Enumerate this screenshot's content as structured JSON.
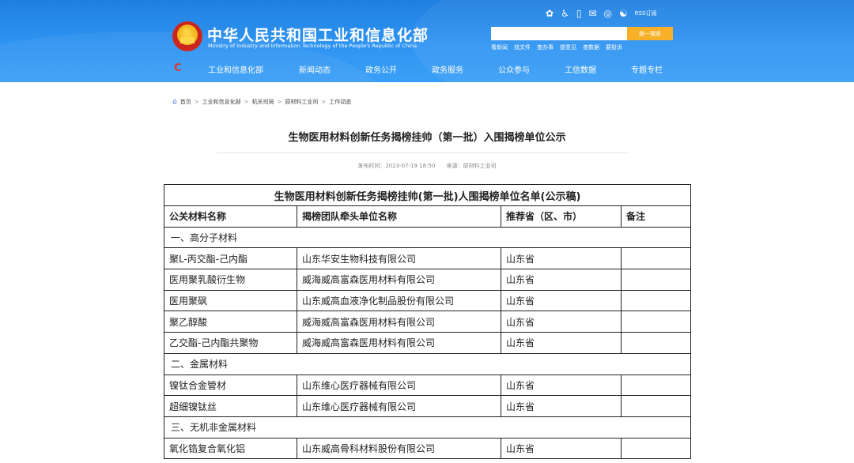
{
  "header": {
    "site_title": "中华人民共和国工业和信息化部",
    "site_subtitle": "Ministry of Industry and Information Technology of the People's Republic of China",
    "utility_icons": [
      "wechat-icon",
      "accessibility-icon",
      "mobile-icon",
      "mail-icon",
      "chat-icon",
      "weibo-icon"
    ],
    "rss_label": "RSS订阅",
    "search": {
      "placeholder": "",
      "button_label": "换一搜索"
    },
    "hot_links": [
      "看新闻",
      "找文件",
      "查办事",
      "提意见",
      "查数据",
      "要投诉"
    ],
    "nav_logo": "C",
    "nav": [
      "工业和信息化部",
      "新闻动态",
      "政务公开",
      "政务服务",
      "公众参与",
      "工信数据",
      "专题专栏"
    ]
  },
  "breadcrumb": [
    "首页",
    "工业和信息化部",
    "机关司局",
    "原材料工业司",
    "工作动态"
  ],
  "article": {
    "title": "生物医用材料创新任务揭榜挂帅（第一批）入围揭榜单位公示",
    "publish_time": "发布时间：2023-07-19 18:50",
    "source": "来源：原材料工业司"
  },
  "table": {
    "caption": "生物医用材料创新任务揭榜挂帅(第一批)人围揭榜单位名单(公示稿)",
    "headers": [
      "公关材料名称",
      "揭榜团队牵头单位名称",
      "推荐省（区、市）",
      "备注"
    ],
    "rows": [
      {
        "category": "一、高分子材料"
      },
      {
        "cells": [
          "聚L-丙交酯-己内酯",
          "山东华安生物科技有限公司",
          "山东省",
          ""
        ]
      },
      {
        "cells": [
          "医用聚乳酸衍生物",
          "威海威高富森医用材料有限公司",
          "山东省",
          ""
        ]
      },
      {
        "cells": [
          "医用聚砜",
          "山东威高血液净化制品股份有限公司",
          "山东省",
          ""
        ]
      },
      {
        "cells": [
          "聚乙醇酸",
          "威海威高富森医用材料有限公司",
          "山东省",
          ""
        ]
      },
      {
        "cells": [
          "乙交酯-己内酯共聚物",
          "威海威高富森医用材料有限公司",
          "山东省",
          ""
        ]
      },
      {
        "category": "二、金属材料"
      },
      {
        "cells": [
          "镍钛合金管材",
          "山东维心医疗器械有限公司",
          "山东省",
          ""
        ]
      },
      {
        "cells": [
          "超细镍钛丝",
          "山东维心医疗器械有限公司",
          "山东省",
          ""
        ]
      },
      {
        "category": "三、无机非金属材料"
      },
      {
        "cells": [
          "氧化锆复合氧化铝",
          "山东威高骨科材料股份有限公司",
          "山东省",
          ""
        ]
      }
    ]
  },
  "colors": {
    "header_blue": "#2f94f2",
    "search_button": "#f7b027",
    "nav_logo": "#e1352a",
    "table_border": "#222222"
  }
}
